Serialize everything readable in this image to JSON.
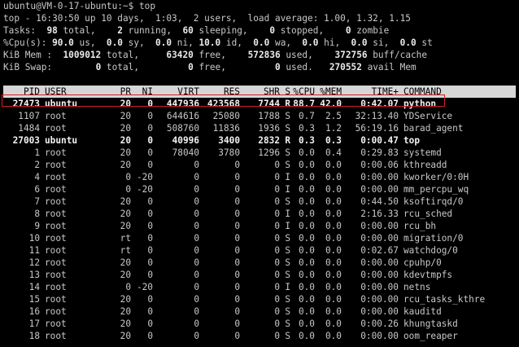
{
  "prompt": "ubuntu@VM-0-17-ubuntu:~$ top",
  "summary": {
    "top_line": "top - 16:30:50 up 10 days,  1:03,  2 users,  load average: 1.00, 1.32, 1.15",
    "tasks": {
      "label": "Tasks:",
      "total": "98",
      "running": "2",
      "sleeping": "60",
      "stopped": "0",
      "zombie": "0"
    },
    "cpu": {
      "label": "%Cpu(s):",
      "us": "90.0",
      "sy": "0.0",
      "ni": "0.0",
      "id": "10.0",
      "wa": "0.0",
      "hi": "0.0",
      "si": "0.0",
      "st": "0.0"
    },
    "mem": {
      "label": "KiB Mem :",
      "total": "1009012",
      "free": "63420",
      "used": "572836",
      "buff": "372756"
    },
    "swap": {
      "label": "KiB Swap:",
      "total": "0",
      "free": "0",
      "used": "0",
      "avail": "270552"
    }
  },
  "table": {
    "headers": [
      "PID",
      "USER",
      "PR",
      "NI",
      "VIRT",
      "RES",
      "SHR",
      "S",
      "%CPU",
      "%MEM",
      "TIME+",
      "COMMAND"
    ],
    "rows": [
      {
        "bold": true,
        "cells": [
          "27473",
          "ubuntu",
          "20",
          "0",
          "447936",
          "423568",
          "7744",
          "R",
          "88.7",
          "42.0",
          "0:42.07",
          "python"
        ]
      },
      {
        "bold": false,
        "cells": [
          "1107",
          "root",
          "20",
          "0",
          "644616",
          "25080",
          "1788",
          "S",
          "0.7",
          "2.5",
          "32:13.40",
          "YDService"
        ]
      },
      {
        "bold": false,
        "cells": [
          "1484",
          "root",
          "20",
          "0",
          "508760",
          "11836",
          "1936",
          "S",
          "0.3",
          "1.2",
          "56:19.16",
          "barad_agent"
        ]
      },
      {
        "bold": true,
        "cells": [
          "27003",
          "ubuntu",
          "20",
          "0",
          "40996",
          "3400",
          "2832",
          "R",
          "0.3",
          "0.3",
          "0:00.47",
          "top"
        ]
      },
      {
        "bold": false,
        "cells": [
          "1",
          "root",
          "20",
          "0",
          "78040",
          "3780",
          "1296",
          "S",
          "0.0",
          "0.4",
          "0:29.83",
          "systemd"
        ]
      },
      {
        "bold": false,
        "cells": [
          "2",
          "root",
          "20",
          "0",
          "0",
          "0",
          "0",
          "S",
          "0.0",
          "0.0",
          "0:00.06",
          "kthreadd"
        ]
      },
      {
        "bold": false,
        "cells": [
          "4",
          "root",
          "0",
          "-20",
          "0",
          "0",
          "0",
          "I",
          "0.0",
          "0.0",
          "0:00.00",
          "kworker/0:0H"
        ]
      },
      {
        "bold": false,
        "cells": [
          "6",
          "root",
          "0",
          "-20",
          "0",
          "0",
          "0",
          "I",
          "0.0",
          "0.0",
          "0:00.00",
          "mm_percpu_wq"
        ]
      },
      {
        "bold": false,
        "cells": [
          "7",
          "root",
          "20",
          "0",
          "0",
          "0",
          "0",
          "S",
          "0.0",
          "0.0",
          "0:44.50",
          "ksoftirqd/0"
        ]
      },
      {
        "bold": false,
        "cells": [
          "8",
          "root",
          "20",
          "0",
          "0",
          "0",
          "0",
          "I",
          "0.0",
          "0.0",
          "2:16.33",
          "rcu_sched"
        ]
      },
      {
        "bold": false,
        "cells": [
          "9",
          "root",
          "20",
          "0",
          "0",
          "0",
          "0",
          "I",
          "0.0",
          "0.0",
          "0:00.00",
          "rcu_bh"
        ]
      },
      {
        "bold": false,
        "cells": [
          "10",
          "root",
          "rt",
          "0",
          "0",
          "0",
          "0",
          "S",
          "0.0",
          "0.0",
          "0:00.00",
          "migration/0"
        ]
      },
      {
        "bold": false,
        "cells": [
          "11",
          "root",
          "rt",
          "0",
          "0",
          "0",
          "0",
          "S",
          "0.0",
          "0.0",
          "0:02.67",
          "watchdog/0"
        ]
      },
      {
        "bold": false,
        "cells": [
          "12",
          "root",
          "20",
          "0",
          "0",
          "0",
          "0",
          "S",
          "0.0",
          "0.0",
          "0:00.00",
          "cpuhp/0"
        ]
      },
      {
        "bold": false,
        "cells": [
          "13",
          "root",
          "20",
          "0",
          "0",
          "0",
          "0",
          "S",
          "0.0",
          "0.0",
          "0:00.00",
          "kdevtmpfs"
        ]
      },
      {
        "bold": false,
        "cells": [
          "14",
          "root",
          "0",
          "-20",
          "0",
          "0",
          "0",
          "I",
          "0.0",
          "0.0",
          "0:00.00",
          "netns"
        ]
      },
      {
        "bold": false,
        "cells": [
          "15",
          "root",
          "20",
          "0",
          "0",
          "0",
          "0",
          "S",
          "0.0",
          "0.0",
          "0:00.00",
          "rcu_tasks_kthre"
        ]
      },
      {
        "bold": false,
        "cells": [
          "16",
          "root",
          "20",
          "0",
          "0",
          "0",
          "0",
          "S",
          "0.0",
          "0.0",
          "0:00.00",
          "kauditd"
        ]
      },
      {
        "bold": false,
        "cells": [
          "17",
          "root",
          "20",
          "0",
          "0",
          "0",
          "0",
          "S",
          "0.0",
          "0.0",
          "0:00.26",
          "khungtaskd"
        ]
      },
      {
        "bold": false,
        "cells": [
          "18",
          "root",
          "20",
          "0",
          "0",
          "0",
          "0",
          "S",
          "0.0",
          "0.0",
          "0:00.00",
          "oom_reaper"
        ]
      }
    ]
  },
  "colors": {
    "background": "#000000",
    "text": "#c8c8c8",
    "header_bg": "#d6d6d6",
    "highlight_border": "#d21f2a"
  }
}
